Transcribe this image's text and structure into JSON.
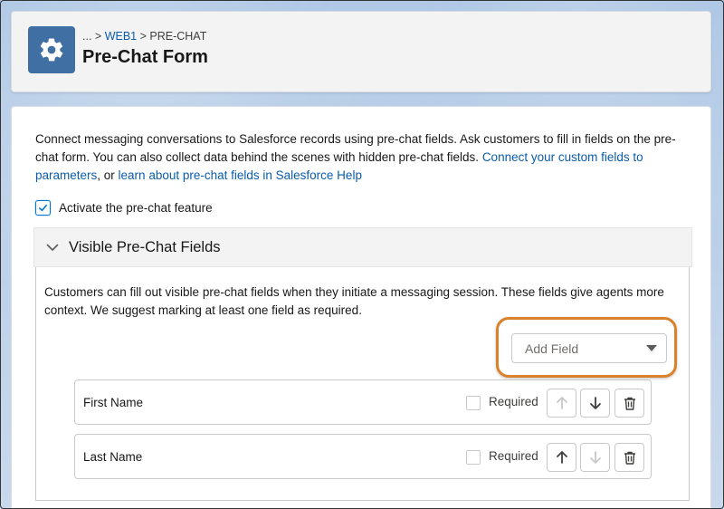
{
  "header": {
    "breadcrumb_prefix": "... >",
    "breadcrumb_link": "WEB1",
    "breadcrumb_current": "> PRE-CHAT",
    "title": "Pre-Chat Form",
    "icon": "gear-icon"
  },
  "intro": {
    "text": "Connect messaging conversations to Salesforce records using pre-chat fields. Ask customers to fill in fields on the pre-chat form. You can also collect data behind the scenes with hidden pre-chat fields. ",
    "link1": "Connect your custom fields to parameters",
    "separator": ", or ",
    "link2": "learn about pre-chat fields in Salesforce Help"
  },
  "activate": {
    "label": "Activate the pre-chat feature",
    "checked": true
  },
  "visible_section": {
    "title": "Visible Pre-Chat Fields",
    "description": "Customers can fill out visible pre-chat fields when they initiate a messaging session. These fields give agents more context. We suggest marking at least one field as required.",
    "add_field_placeholder": "Add Field",
    "required_label": "Required",
    "fields": [
      {
        "label": "First Name",
        "required": false
      },
      {
        "label": "Last Name",
        "required": false
      }
    ]
  },
  "colors": {
    "accent": "#0176d3",
    "link": "#0b5cab",
    "highlight": "#d9822b",
    "header_icon_bg": "#3f6fa3"
  }
}
